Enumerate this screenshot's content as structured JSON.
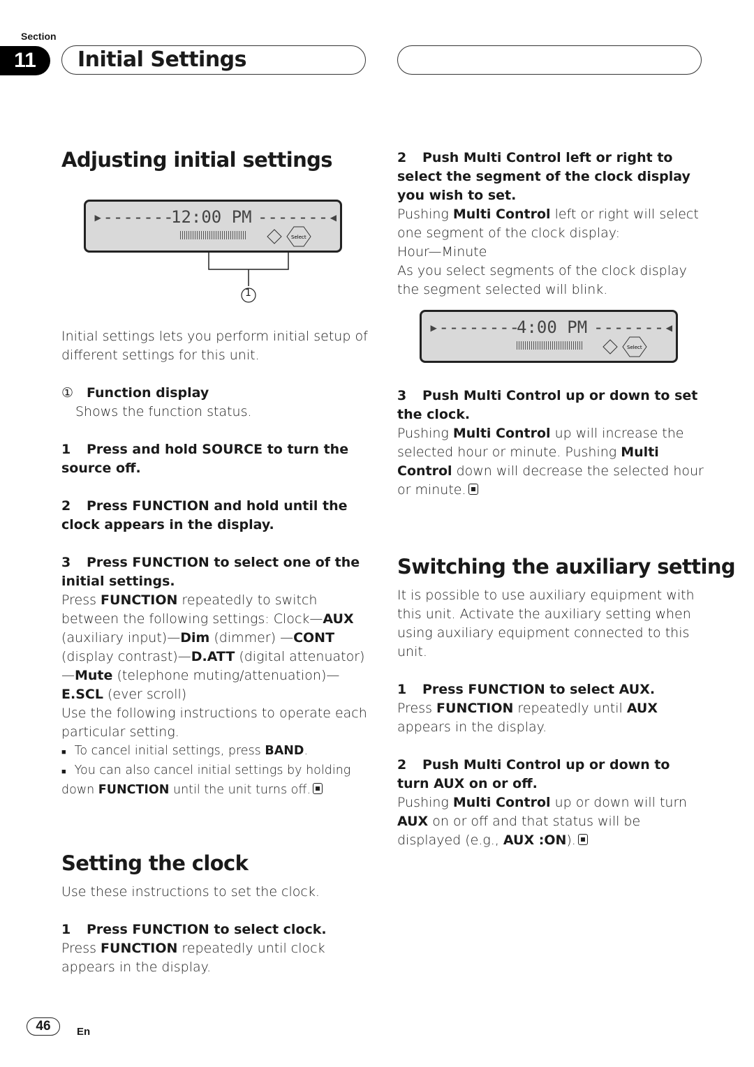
{
  "header": {
    "section_label": "Section",
    "section_number": "11",
    "section_title": "Initial Settings"
  },
  "left": {
    "heading": "Adjusting initial settings",
    "display1": {
      "clock_text": "12:00 PM",
      "callout_number": "1"
    },
    "intro": "Initial settings lets you perform initial setup of different settings for this unit.",
    "callout": {
      "marker": "①",
      "title": "Function display",
      "desc": "Shows the function status."
    },
    "step1": {
      "num": "1",
      "text": "Press and hold SOURCE to turn the source off."
    },
    "step2": {
      "num": "2",
      "text": "Press FUNCTION and hold until the clock appears in the display."
    },
    "step3": {
      "num": "3",
      "text": "Press FUNCTION to select one of the initial settings."
    },
    "step3_body": {
      "a": "Press ",
      "b": "FUNCTION",
      "c": " repeatedly to switch between the following settings:",
      "clock": "Clock—",
      "aux": "AUX",
      "aux_d": " (auxiliary input)—",
      "dim": "Dim",
      "dim_d": " (dimmer)",
      "cont_pre": "—",
      "cont": "CONT",
      "cont_d": " (display contrast)—",
      "datt": "D.ATT",
      "datt_d": " (digital attenuator)—",
      "mute": "Mute",
      "mute_d": " (telephone muting/attenuation)—",
      "escl": "E.SCL",
      "escl_d": " (ever scroll)",
      "use": "Use the following instructions to operate each particular setting."
    },
    "note1": {
      "bullet": "■",
      "a": "To cancel initial settings, press ",
      "b": "BAND",
      "c": "."
    },
    "note2": {
      "bullet": "■",
      "a": "You can also cancel initial settings by holding down ",
      "b": "FUNCTION",
      "c": " until the unit turns off."
    },
    "clock_heading": "Setting the clock",
    "clock_intro": "Use these instructions to set the clock.",
    "clock_step1": {
      "num": "1",
      "text": "Press FUNCTION to select clock."
    },
    "clock_step1_body": {
      "a": "Press ",
      "b": "FUNCTION",
      "c": " repeatedly until clock appears in the display."
    }
  },
  "right": {
    "step2": {
      "num": "2",
      "text": "Push Multi Control left or right to select the segment of the clock display you wish to set."
    },
    "step2_body": {
      "a": "Pushing ",
      "b": "Multi Control",
      "c": " left or right will select one segment of the clock display:",
      "seq": "Hour—Minute",
      "blink": "As you select segments of the clock display the segment selected will blink."
    },
    "display2": {
      "clock_text": "4:00 PM"
    },
    "step3": {
      "num": "3",
      "text": "Push Multi Control up or down to set the clock."
    },
    "step3_body": {
      "a": "Pushing ",
      "b": "Multi Control",
      "c": " up will increase the selected hour or minute. Pushing ",
      "d": "Multi Control",
      "e": " down will decrease the selected hour or minute."
    },
    "aux_heading": "Switching the auxiliary setting",
    "aux_intro": "It is possible to use auxiliary equipment with this unit. Activate the auxiliary setting when using auxiliary equipment connected to this unit.",
    "aux_step1": {
      "num": "1",
      "text": "Press FUNCTION to select AUX."
    },
    "aux_step1_body": {
      "a": "Press ",
      "b": "FUNCTION",
      "c": " repeatedly until ",
      "d": "AUX",
      "e": " appears in the display."
    },
    "aux_step2": {
      "num": "2",
      "text": "Push Multi Control up or down to turn AUX on or off."
    },
    "aux_step2_body": {
      "a": "Pushing ",
      "b": "Multi Control",
      "c": " up or down will turn ",
      "d": "AUX",
      "e": " on or off and that status will be displayed (e.g., ",
      "f": "AUX :ON",
      "g": ")."
    }
  },
  "footer": {
    "page_number": "46",
    "language": "En"
  }
}
